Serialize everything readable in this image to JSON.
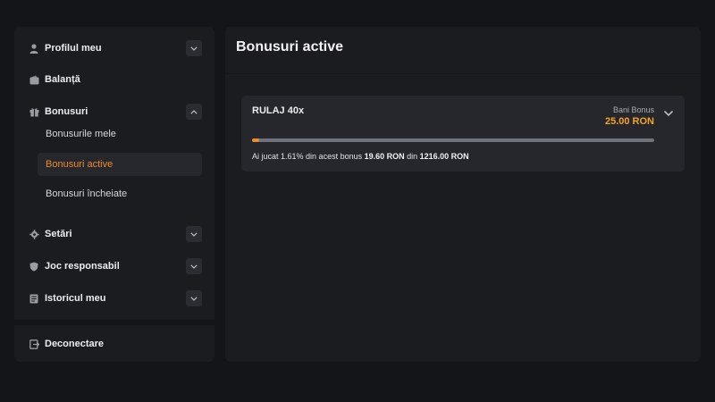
{
  "sidebar": {
    "items": [
      {
        "label": "Profilul meu",
        "icon": "user-icon",
        "expandable": true,
        "expanded": false
      },
      {
        "label": "Balanță",
        "icon": "wallet-icon",
        "expandable": false
      },
      {
        "label": "Bonusuri",
        "icon": "gift-icon",
        "expandable": true,
        "expanded": true
      },
      {
        "label": "Setări",
        "icon": "gear-icon",
        "expandable": true,
        "expanded": false
      },
      {
        "label": "Joc responsabil",
        "icon": "shield-icon",
        "expandable": true,
        "expanded": false
      },
      {
        "label": "Istoricul meu",
        "icon": "history-icon",
        "expandable": true,
        "expanded": false
      }
    ],
    "bonus_subitems": [
      {
        "label": "Bonusurile mele",
        "active": false
      },
      {
        "label": "Bonusuri active",
        "active": true
      },
      {
        "label": "Bonusuri încheiate",
        "active": false
      }
    ],
    "logout_label": "Deconectare",
    "logout_icon": "logout-icon"
  },
  "main": {
    "title": "Bonusuri active",
    "bonus_card": {
      "title": "RULAJ 40x",
      "type_label": "Bani Bonus",
      "amount": "25.00 RON",
      "progress_percent": 1.61,
      "progress_prefix": "Ai jucat ",
      "progress_pct_text": "1.61%",
      "progress_middle": " din acest bonus ",
      "played_amount": "19.60 RON",
      "progress_from": " din ",
      "required_amount": "1216.00 RON"
    }
  },
  "colors": {
    "accent": "#f08a24",
    "amount": "#f5a524",
    "background": "#141518",
    "panel": "#1b1c20",
    "card": "#25272c"
  }
}
